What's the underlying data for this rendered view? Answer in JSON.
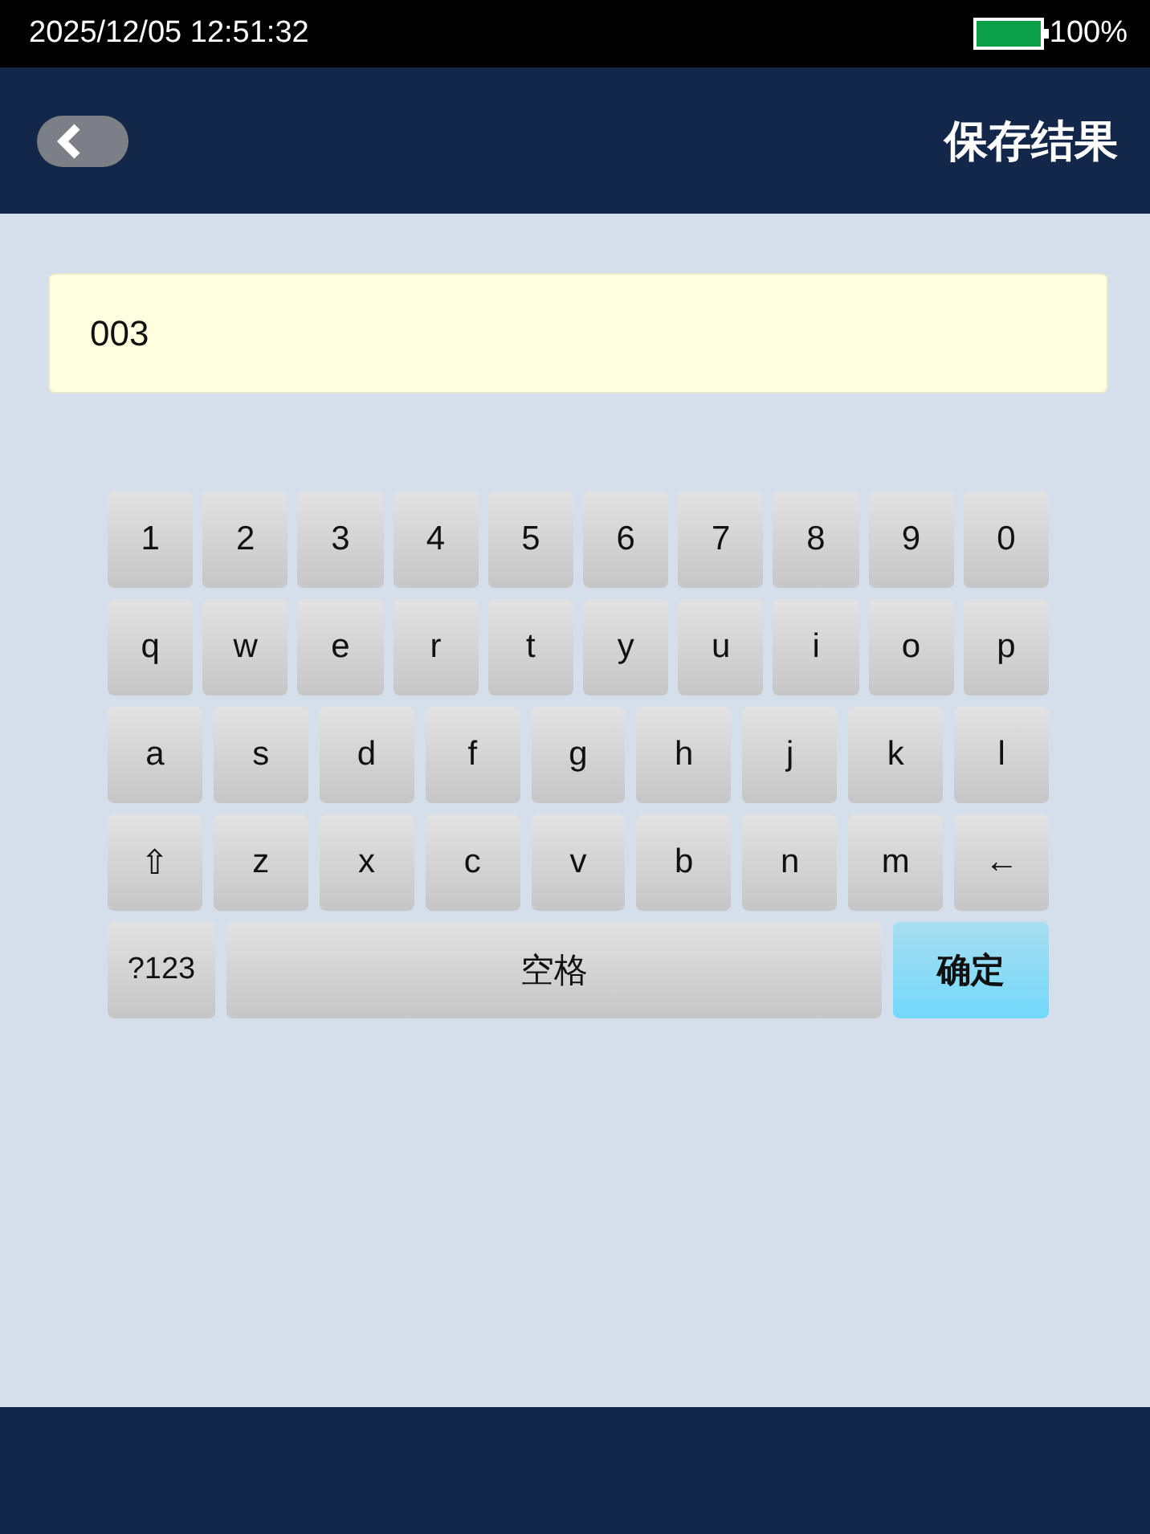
{
  "status_bar": {
    "datetime": "2025/12/05 12:51:32",
    "battery": "100%"
  },
  "header": {
    "title": "保存结果"
  },
  "input": {
    "value": "003"
  },
  "keyboard": {
    "rows": [
      [
        "1",
        "2",
        "3",
        "4",
        "5",
        "6",
        "7",
        "8",
        "9",
        "0"
      ],
      [
        "q",
        "w",
        "e",
        "r",
        "t",
        "y",
        "u",
        "i",
        "o",
        "p"
      ],
      [
        "a",
        "s",
        "d",
        "f",
        "g",
        "h",
        "j",
        "k",
        "l"
      ],
      [
        "⇧",
        "z",
        "x",
        "c",
        "v",
        "b",
        "n",
        "m",
        "←"
      ]
    ],
    "bottom_keys": [
      {
        "label": "?123",
        "kind": "symbols"
      },
      {
        "label": "空格",
        "kind": "space"
      },
      {
        "label": "确定",
        "kind": "confirm"
      }
    ]
  }
}
